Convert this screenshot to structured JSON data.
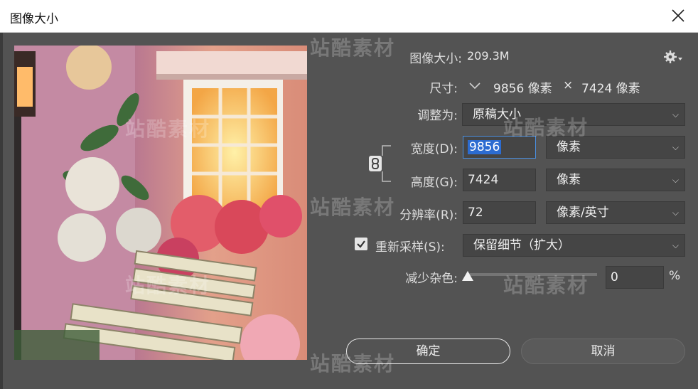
{
  "window": {
    "title": "图像大小"
  },
  "info": {
    "image_size_label": "图像大小:",
    "image_size_value": "209.3M",
    "dimensions_label": "尺寸:",
    "width_px": "9856 像素",
    "times": "×",
    "height_px": "7424 像素"
  },
  "fit_to": {
    "label": "调整为:",
    "value": "原稿大小"
  },
  "width": {
    "label": "宽度(D):",
    "value": "9856",
    "unit": "像素"
  },
  "height": {
    "label": "高度(G):",
    "value": "7424",
    "unit": "像素"
  },
  "resolution": {
    "label": "分辨率(R):",
    "value": "72",
    "unit": "像素/英寸"
  },
  "resample": {
    "label": "重新采样(S):",
    "checked": true,
    "value": "保留细节（扩大）"
  },
  "noise": {
    "label": "减少杂色:",
    "value": "0",
    "unit": "%",
    "level": 0
  },
  "buttons": {
    "ok": "确定",
    "cancel": "取消"
  },
  "watermark": "站酷素材",
  "colors": {
    "accent": "#4a8fe0",
    "dialog_bg": "#535353",
    "field_bg": "#454545"
  }
}
